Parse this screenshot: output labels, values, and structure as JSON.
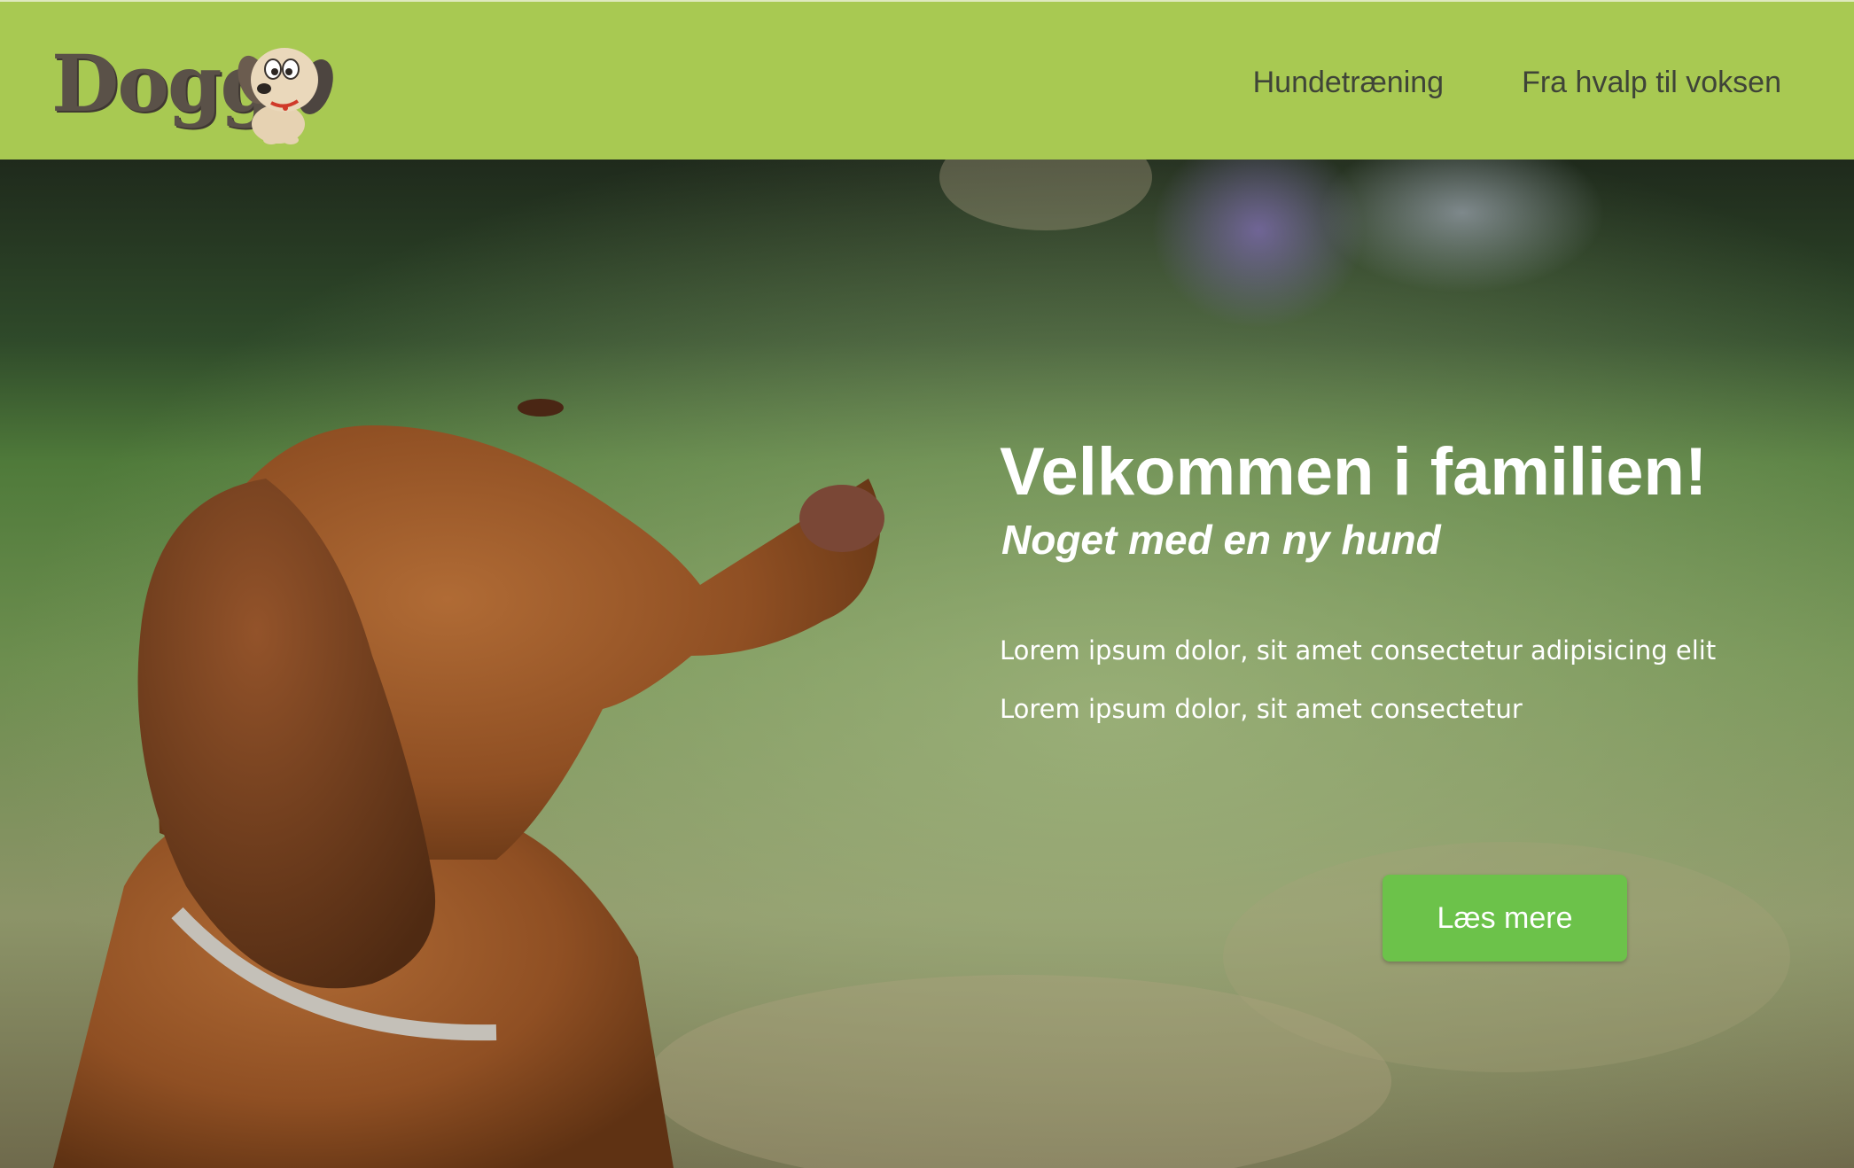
{
  "header": {
    "logo_text": "Dogg",
    "nav": [
      {
        "label": "Hundetræning"
      },
      {
        "label": "Fra hvalp til voksen"
      }
    ]
  },
  "hero": {
    "title": "Velkommen i familien!",
    "subtitle": "Noget med en ny hund",
    "lines": [
      "Lorem ipsum dolor, sit amet consectetur adipisicing elit",
      "Lorem ipsum dolor, sit amet consectetur"
    ],
    "cta_label": "Læs mere"
  },
  "colors": {
    "header_bg": "#a8c952",
    "cta_bg": "#6cc24a",
    "nav_text": "#3f4438"
  }
}
